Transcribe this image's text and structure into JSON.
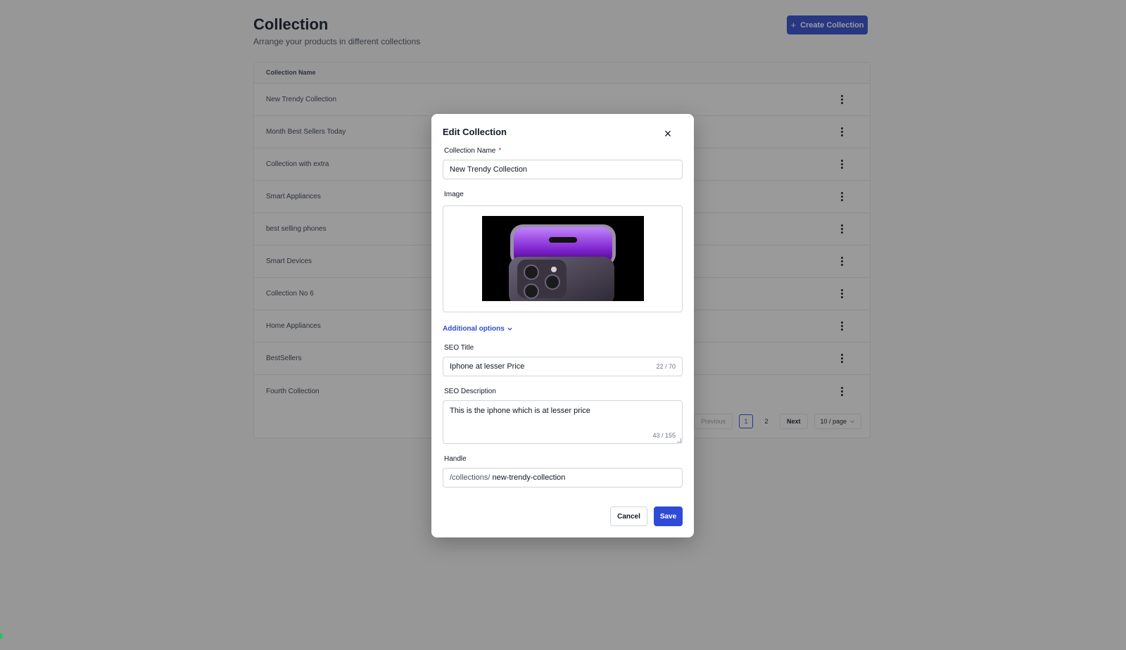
{
  "page": {
    "title": "Collection",
    "subtitle": "Arrange your products in different collections",
    "create_button": "Create Collection",
    "create_icon": "+"
  },
  "table": {
    "column_header": "Collection Name",
    "rows": [
      "New Trendy Collection",
      "Month Best Sellers Today",
      "Collection with extra",
      "Smart Appliances",
      "best selling phones",
      "Smart Devices",
      "Collection No 6",
      "Home Appliances",
      "BestSellers",
      "Fourth Collection"
    ]
  },
  "pagination": {
    "previous": "Previous",
    "pages": [
      "1",
      "2"
    ],
    "current": "1",
    "next": "Next",
    "per_page": "10 / page"
  },
  "modal": {
    "title": "Edit Collection",
    "close_icon": "×",
    "name_label": "Collection Name",
    "required_mark": "*",
    "name_value": "New Trendy Collection",
    "image_label": "Image",
    "additional_options": "Additional options",
    "seo_title_label": "SEO Title",
    "seo_title_value": "Iphone at lesser Price",
    "seo_title_counter": "22 / 70",
    "seo_desc_label": "SEO Description",
    "seo_desc_value": "This is the iphone which is at lesser price",
    "seo_desc_counter": "43 / 155",
    "handle_label": "Handle",
    "handle_prefix": "/collections/",
    "handle_value": "new-trendy-collection",
    "cancel": "Cancel",
    "save": "Save"
  },
  "colors": {
    "primary": "#2f4bd6",
    "required": "#dc2626",
    "status_dot": "#22c55e"
  }
}
